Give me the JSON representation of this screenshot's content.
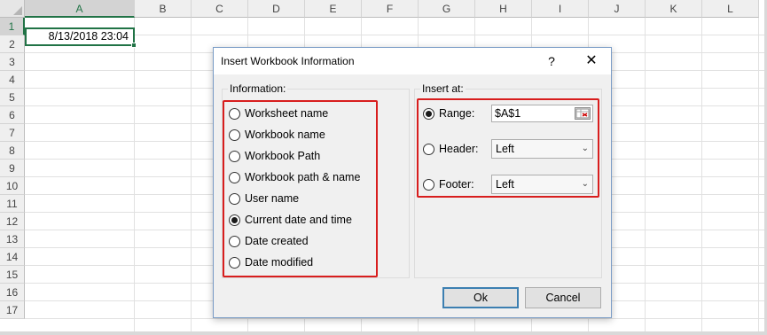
{
  "sheet": {
    "columns": [
      "A",
      "B",
      "C",
      "D",
      "E",
      "F",
      "G",
      "H",
      "I",
      "J",
      "K",
      "L"
    ],
    "rows": [
      "1",
      "2",
      "3",
      "4",
      "5",
      "6",
      "7",
      "8",
      "9",
      "10",
      "11",
      "12",
      "13",
      "14",
      "15",
      "16",
      "17"
    ],
    "selected_column": "A",
    "selected_row": "1",
    "cell_a1_value": "8/13/2018 23:04",
    "accent_color": "#217346"
  },
  "dialog": {
    "title": "Insert Workbook Information",
    "help_label": "?",
    "close_label": "✕",
    "information_label": "Information:",
    "information_options": [
      {
        "label": "Worksheet name",
        "checked": false
      },
      {
        "label": "Workbook name",
        "checked": false
      },
      {
        "label": "Workbook Path",
        "checked": false
      },
      {
        "label": "Workbook path & name",
        "checked": false
      },
      {
        "label": "User name",
        "checked": false
      },
      {
        "label": "Current date and time",
        "checked": true
      },
      {
        "label": "Date created",
        "checked": false
      },
      {
        "label": "Date modified",
        "checked": false
      }
    ],
    "insert_at_label": "Insert at:",
    "range_label": "Range:",
    "range_value": "$A$1",
    "range_checked": true,
    "header_label": "Header:",
    "header_value": "Left",
    "header_checked": false,
    "footer_label": "Footer:",
    "footer_value": "Left",
    "footer_checked": false,
    "ok_label": "Ok",
    "cancel_label": "Cancel",
    "highlight_color": "#d81e1e"
  }
}
